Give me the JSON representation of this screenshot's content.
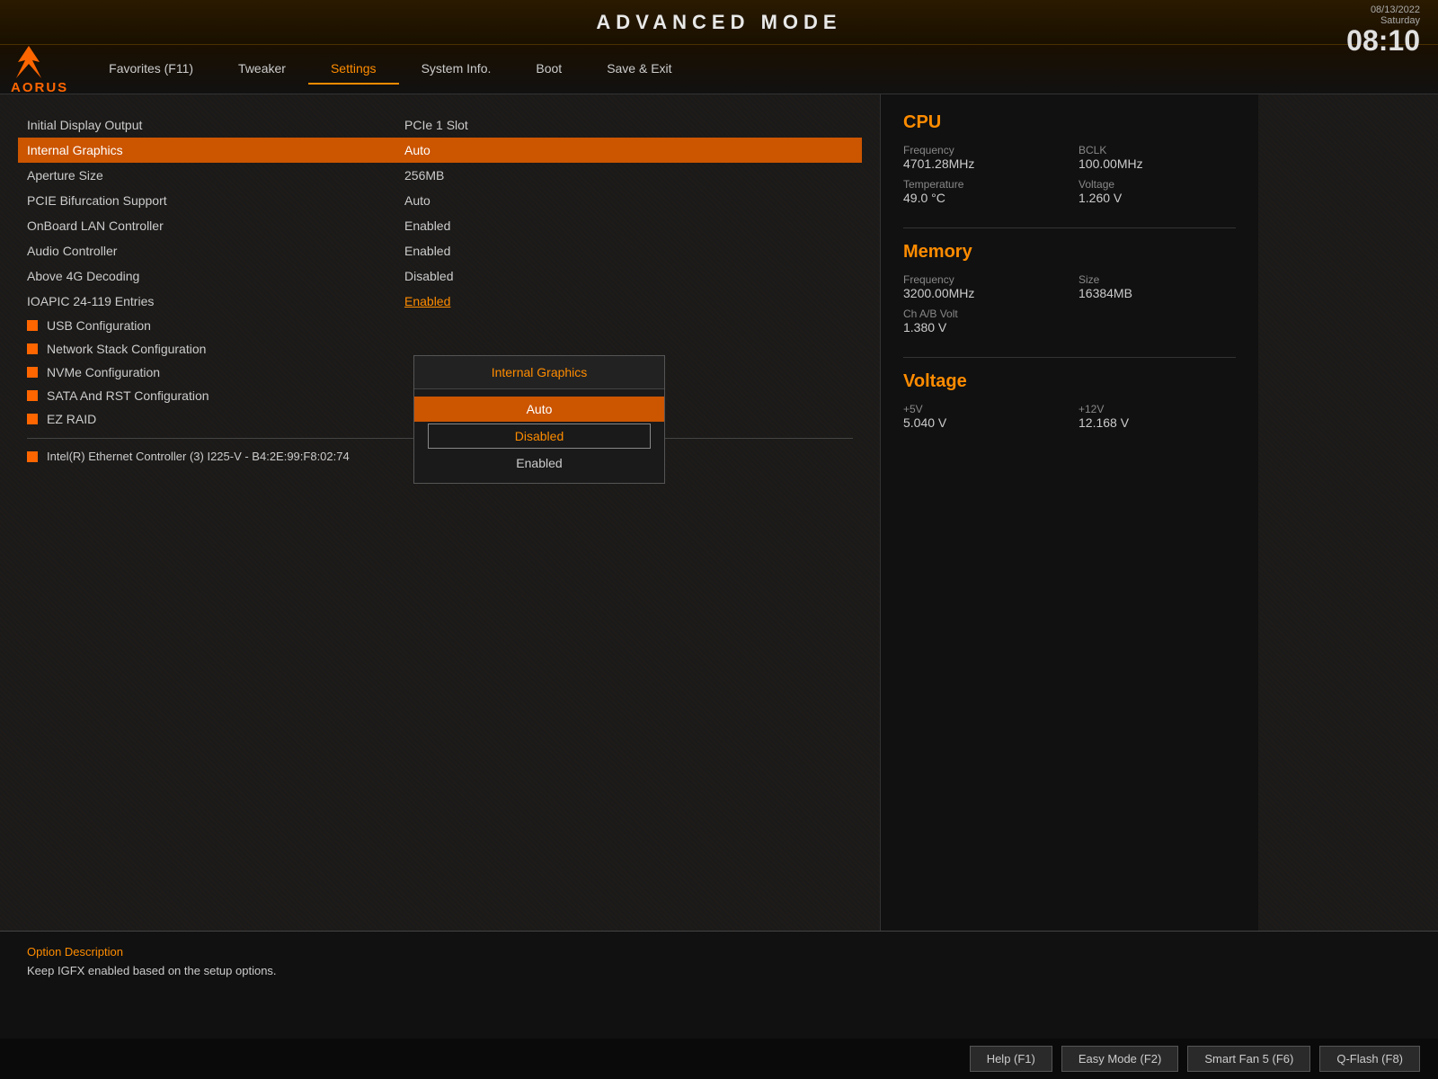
{
  "header": {
    "title": "ADVANCED MODE",
    "date": "08/13/2022",
    "day": "Saturday",
    "time": "08:10"
  },
  "navbar": {
    "items": [
      {
        "id": "favorites",
        "label": "Favorites (F11)",
        "active": false
      },
      {
        "id": "tweaker",
        "label": "Tweaker",
        "active": false
      },
      {
        "id": "settings",
        "label": "Settings",
        "active": true
      },
      {
        "id": "sysinfo",
        "label": "System Info.",
        "active": false
      },
      {
        "id": "boot",
        "label": "Boot",
        "active": false
      },
      {
        "id": "saveexit",
        "label": "Save & Exit",
        "active": false
      }
    ]
  },
  "settings": {
    "rows": [
      {
        "name": "Initial Display Output",
        "value": "PCIe 1 Slot",
        "highlighted": false
      },
      {
        "name": "Internal Graphics",
        "value": "Auto",
        "highlighted": true
      },
      {
        "name": "Aperture Size",
        "value": "256MB",
        "highlighted": false
      },
      {
        "name": "PCIE Bifurcation Support",
        "value": "Auto",
        "highlighted": false
      },
      {
        "name": "OnBoard LAN Controller",
        "value": "Enabled",
        "highlighted": false
      },
      {
        "name": "Audio Controller",
        "value": "Enabled",
        "highlighted": false
      },
      {
        "name": "Above 4G Decoding",
        "value": "Disabled",
        "highlighted": false
      },
      {
        "name": "IOAPIC 24-119 Entries",
        "value": "Enabled",
        "highlighted": false
      }
    ],
    "subItems": [
      "USB Configuration",
      "Network Stack Configuration",
      "NVMe Configuration",
      "SATA And RST Configuration",
      "EZ RAID"
    ],
    "networkInfo": "Intel(R) Ethernet Controller (3) I225-V - B4:2E:99:F8:02:74"
  },
  "dropdown": {
    "title": "Internal Graphics",
    "options": [
      {
        "label": "Auto",
        "style": "selected-auto"
      },
      {
        "label": "Disabled",
        "style": "selected-disabled"
      },
      {
        "label": "Enabled",
        "style": "normal"
      }
    ]
  },
  "cpu": {
    "title": "CPU",
    "frequency_label": "Frequency",
    "frequency_value": "4701.28MHz",
    "bclk_label": "BCLK",
    "bclk_value": "100.00MHz",
    "temperature_label": "Temperature",
    "temperature_value": "49.0 °C",
    "voltage_label": "Voltage",
    "voltage_value": "1.260 V"
  },
  "memory": {
    "title": "Memory",
    "frequency_label": "Frequency",
    "frequency_value": "3200.00MHz",
    "size_label": "Size",
    "size_value": "16384MB",
    "chavolt_label": "Ch A/B Volt",
    "chavolt_value": "1.380 V"
  },
  "voltage": {
    "title": "Voltage",
    "plus5v_label": "+5V",
    "plus5v_value": "5.040 V",
    "plus12v_label": "+12V",
    "plus12v_value": "12.168 V"
  },
  "footer": {
    "option_desc_label": "Option Description",
    "option_desc_text": "Keep IGFX enabled based on the setup options.",
    "buttons": [
      {
        "id": "help",
        "label": "Help (F1)"
      },
      {
        "id": "easymode",
        "label": "Easy Mode (F2)"
      },
      {
        "id": "smartfan",
        "label": "Smart Fan 5 (F6)"
      },
      {
        "id": "qflash",
        "label": "Q-Flash (F8)"
      }
    ]
  }
}
